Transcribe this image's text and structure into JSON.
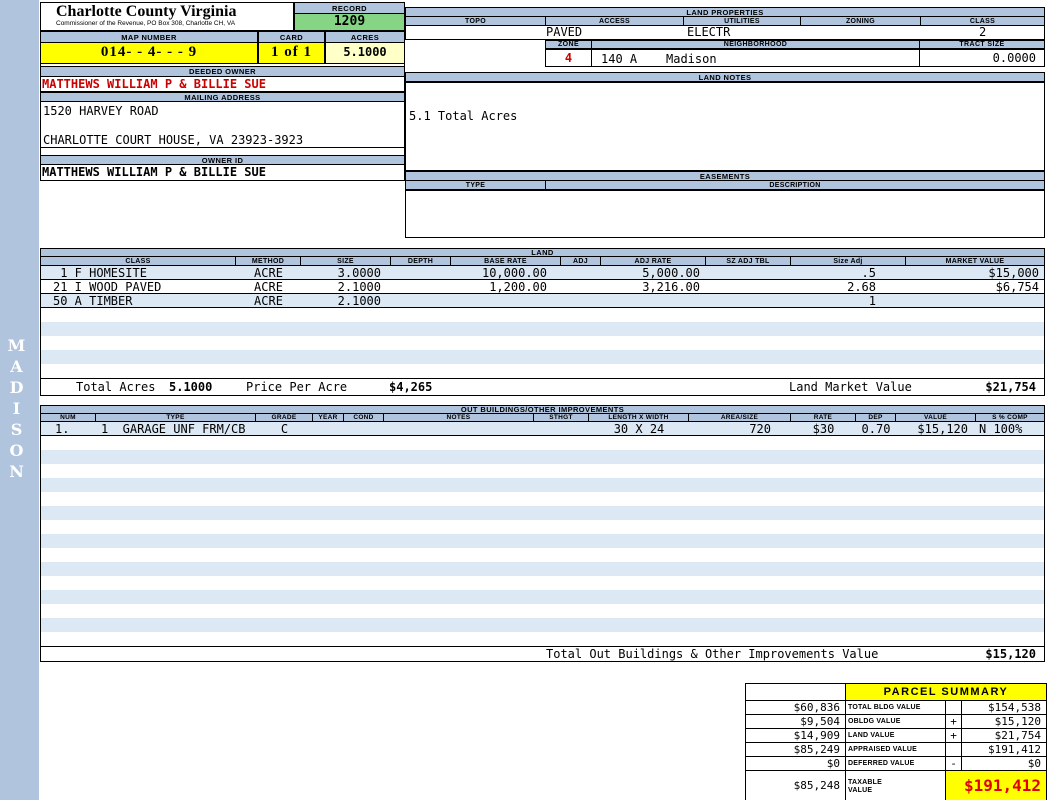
{
  "colors": {
    "header_bar": "#B0C4DE",
    "row_stripe": "#DCE8F4",
    "highlight_yellow": "#FFFF00",
    "pale_yellow": "#FFFFC8",
    "record_green": "#85D585",
    "alert_red": "#CC0000"
  },
  "sidebar": {
    "district": "MADISON"
  },
  "header": {
    "county": "Charlotte County Virginia",
    "subtitle": "Commissioner of the Revenue, PO Box 308, Charlotte CH, VA",
    "record_label": "RECORD",
    "record_value": "1209",
    "map_number_label": "MAP NUMBER",
    "map_number": "014- - 4- - - 9",
    "card_label": "CARD",
    "card_value": "1 of 1",
    "acres_label": "ACRES",
    "acres_value": "5.1000"
  },
  "owner": {
    "deeded_owner_label": "DEEDED OWNER",
    "deeded_owner": "MATTHEWS WILLIAM P & BILLIE SUE",
    "mailing_address_label": "MAILING ADDRESS",
    "address_line1": "1520 HARVEY ROAD",
    "address_line2": "CHARLOTTE COURT HOUSE, VA 23923-3923",
    "owner_id_label": "OWNER ID",
    "owner_id": "MATTHEWS WILLIAM P & BILLIE SUE"
  },
  "land_properties": {
    "title": "LAND PROPERTIES",
    "col_topo": "TOPO",
    "col_access": "ACCESS",
    "col_utilities": "UTILITIES",
    "col_zoning": "ZONING",
    "col_class": "CLASS",
    "access_value": "PAVED",
    "utilities_value": "ELECTR",
    "class_value": "2",
    "zone_label": "ZONE",
    "zone_value": "4",
    "neighborhood_label": "NEIGHBORHOOD",
    "neighborhood_code": "140 A",
    "neighborhood_name": "Madison",
    "tract_size_label": "TRACT SIZE",
    "tract_size_value": "0.0000"
  },
  "land_notes": {
    "title": "LAND NOTES",
    "note": "5.1 Total Acres"
  },
  "easements": {
    "title": "EASEMENTS",
    "col_type": "TYPE",
    "col_description": "DESCRIPTION"
  },
  "land_table": {
    "title": "LAND",
    "headers": [
      "CLASS",
      "METHOD",
      "SIZE",
      "DEPTH",
      "BASE RATE",
      "ADJ",
      "ADJ RATE",
      "SZ ADJ TBL",
      "Size Adj",
      "MARKET VALUE"
    ],
    "rows": [
      {
        "class": " 1 F HOMESITE",
        "method": "ACRE",
        "size": "3.0000",
        "base_rate": "10,000.00",
        "adj_rate": "5,000.00",
        "size_adj": ".5",
        "market_value": "$15,000"
      },
      {
        "class": "21 I WOOD PAVED",
        "method": "ACRE",
        "size": "2.1000",
        "base_rate": "1,200.00",
        "adj_rate": "3,216.00",
        "size_adj": "2.68",
        "market_value": "$6,754"
      },
      {
        "class": "50 A TIMBER",
        "method": "ACRE",
        "size": "2.1000",
        "base_rate": "",
        "adj_rate": "",
        "size_adj": "1",
        "market_value": ""
      }
    ],
    "total_acres_label": "Total Acres",
    "total_acres": "5.1000",
    "price_per_acre_label": "Price Per Acre",
    "price_per_acre": "$4,265",
    "land_market_value_label": "Land Market Value",
    "land_market_value": "$21,754"
  },
  "out_buildings": {
    "title": "OUT BUILDINGS/OTHER IMPROVEMENTS",
    "headers": [
      "NUM",
      "TYPE",
      "GRADE",
      "YEAR",
      "COND",
      "NOTES",
      "STHGT",
      "LENGTH X WIDTH",
      "AREA/SIZE",
      "RATE",
      "DEP",
      "VALUE",
      "S % COMP"
    ],
    "rows": [
      {
        "num": "1.",
        "type": "1  GARAGE UNF FRM/CB",
        "grade": "C",
        "length_width": "30 X 24",
        "area_size": "720",
        "rate": "$30",
        "dep": "0.70",
        "value": "$15,120",
        "s_comp": "N 100%"
      }
    ],
    "total_label": "Total Out Buildings & Other Improvements Value",
    "total_value": "$15,120"
  },
  "parcel_summary": {
    "title": "PARCEL SUMMARY",
    "rows": [
      {
        "prior": "$60,836",
        "label": "TOTAL BLDG VALUE",
        "op": "",
        "value": "$154,538"
      },
      {
        "prior": "$9,504",
        "label": "OBLDG VALUE",
        "op": "+",
        "value": "$15,120"
      },
      {
        "prior": "$14,909",
        "label": "LAND VALUE",
        "op": "+",
        "value": "$21,754"
      },
      {
        "prior": "$85,249",
        "label": "APPRAISED VALUE",
        "op": "",
        "value": "$191,412"
      },
      {
        "prior": "$0",
        "label": "DEFERRED VALUE",
        "op": "-",
        "value": "$0"
      }
    ],
    "taxable": {
      "prior": "$85,248",
      "label": "TAXABLE VALUE",
      "value": "$191,412"
    }
  }
}
